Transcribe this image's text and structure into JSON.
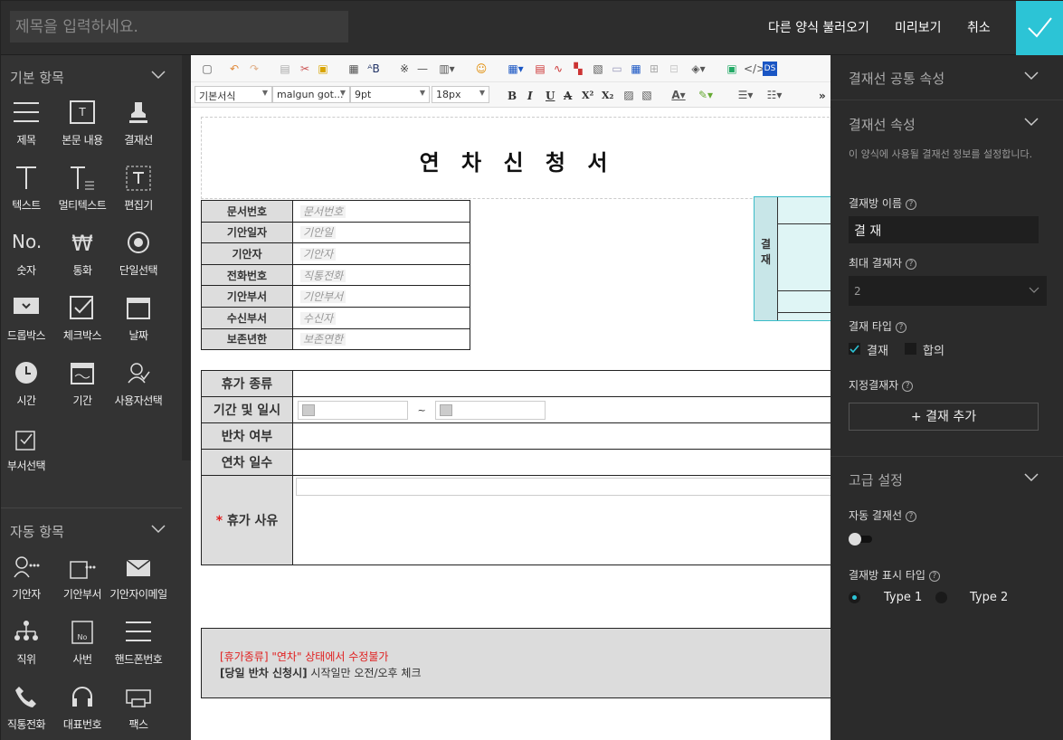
{
  "topbar": {
    "title_placeholder": "제목을 입력하세요.",
    "load_other": "다른 양식 불러오기",
    "preview": "미리보기",
    "cancel": "취소"
  },
  "left": {
    "basic_title": "기본 항목",
    "basic_items": [
      {
        "label": "제목",
        "icon": "title-icon"
      },
      {
        "label": "본문 내용",
        "icon": "body-content-icon"
      },
      {
        "label": "결재선",
        "icon": "approval-line-icon"
      },
      {
        "label": "텍스트",
        "icon": "text-icon"
      },
      {
        "label": "멀티텍스트",
        "icon": "multitext-icon"
      },
      {
        "label": "편집기",
        "icon": "editor-icon"
      },
      {
        "label": "숫자",
        "icon": "number-icon"
      },
      {
        "label": "통화",
        "icon": "currency-icon"
      },
      {
        "label": "단일선택",
        "icon": "radio-icon"
      },
      {
        "label": "드롭박스",
        "icon": "dropbox-icon"
      },
      {
        "label": "체크박스",
        "icon": "checkbox-icon"
      },
      {
        "label": "날짜",
        "icon": "date-icon"
      },
      {
        "label": "시간",
        "icon": "clock-icon"
      },
      {
        "label": "기간",
        "icon": "period-icon"
      },
      {
        "label": "사용자선택",
        "icon": "user-select-icon"
      },
      {
        "label": "부서선택",
        "icon": "dept-select-icon"
      }
    ],
    "auto_title": "자동 항목",
    "auto_items": [
      {
        "label": "기안자",
        "icon": "drafter-icon"
      },
      {
        "label": "기안부서",
        "icon": "draft-dept-icon"
      },
      {
        "label": "기안자이메일",
        "icon": "email-icon"
      },
      {
        "label": "직위",
        "icon": "position-icon"
      },
      {
        "label": "사번",
        "icon": "employee-no-icon"
      },
      {
        "label": "핸드폰번호",
        "icon": "mobile-icon"
      },
      {
        "label": "직통전화",
        "icon": "phone-icon"
      },
      {
        "label": "대표번호",
        "icon": "headset-icon"
      },
      {
        "label": "팩스",
        "icon": "fax-icon"
      }
    ]
  },
  "editor": {
    "style_select": "기본서식",
    "font_select": "malgun got...",
    "size_select": "9pt",
    "line_select": "18px",
    "format_bold": "B",
    "format_italic": "I",
    "format_underline": "U",
    "format_strike": "A",
    "format_sup": "X²",
    "format_sub": "X₂",
    "more": "»",
    "doc_title": "연 차 신 청 서",
    "info_rows": [
      {
        "label": "문서번호",
        "value": "문서번호"
      },
      {
        "label": "기안일자",
        "value": "기안일"
      },
      {
        "label": "기안자",
        "value": "기안자"
      },
      {
        "label": "전화번호",
        "value": "직통전화"
      },
      {
        "label": "기안부서",
        "value": "기안부서"
      },
      {
        "label": "수신부서",
        "value": "수신자"
      },
      {
        "label": "보존년한",
        "value": "보존연한"
      }
    ],
    "approval_label": "결\n재",
    "rows": {
      "vacation_type": "휴가 종류",
      "period": "기간 및 일시",
      "half_day": "반차 여부",
      "days": "연차 일수",
      "reason": "휴가 사유",
      "required": "*",
      "tilde": "~"
    },
    "note_red": "[휴가종류] \"연차\" 상태에서 수정불가",
    "note_bracket": "[당일 반차 신청시]",
    "note_rest": " 시작일만 오전/오후 체크"
  },
  "right": {
    "common_title": "결재선 공통 속성",
    "prop_title": "결재선 속성",
    "desc": "이 양식에 사용될 결재선 정보를 설정합니다.",
    "name_label": "결재방 이름",
    "name_value": "결 재",
    "max_label": "최대 결재자",
    "max_value": "2",
    "type_label": "결재 타입",
    "type_approve": "결재",
    "type_agree": "합의",
    "assigned_label": "지정결재자",
    "add_button": "+ 결재 추가",
    "advanced_title": "고급 설정",
    "auto_label": "자동 결재선",
    "display_label": "결재방 표시 타입",
    "type1": "Type 1",
    "type2": "Type 2",
    "help": "?"
  },
  "colors": {
    "accent": "#2cc4d6",
    "required_red": "#e02020"
  }
}
